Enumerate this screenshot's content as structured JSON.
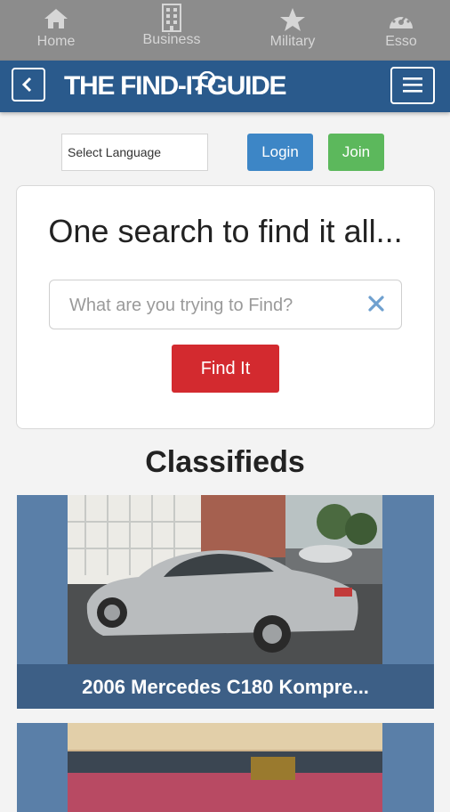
{
  "tabs": [
    {
      "label": "Home",
      "icon": "home-icon"
    },
    {
      "label": "Business",
      "icon": "building-icon"
    },
    {
      "label": "Military",
      "icon": "star-icon"
    },
    {
      "label": "Esso",
      "icon": "gauge-icon"
    }
  ],
  "header": {
    "logo_part1": "THE FIND-IT",
    "logo_part2": "GUIDE",
    "back_icon": "chevron-left-icon",
    "menu_icon": "hamburger-menu-icon"
  },
  "controls": {
    "language_select": "Select Language",
    "login_label": "Login",
    "join_label": "Join"
  },
  "search": {
    "heading": "One search to find it all...",
    "placeholder": "What are you trying to Find?",
    "button_label": "Find It"
  },
  "classifieds": {
    "title": "Classifieds",
    "listings": [
      {
        "caption": "2006 Mercedes C180 Kompre..."
      },
      {
        "caption": ""
      }
    ]
  },
  "colors": {
    "tabbar": "#8c8c8c",
    "header": "#2a5a8c",
    "login": "#3d86c6",
    "join": "#5cb85c",
    "find": "#d32a2f"
  }
}
